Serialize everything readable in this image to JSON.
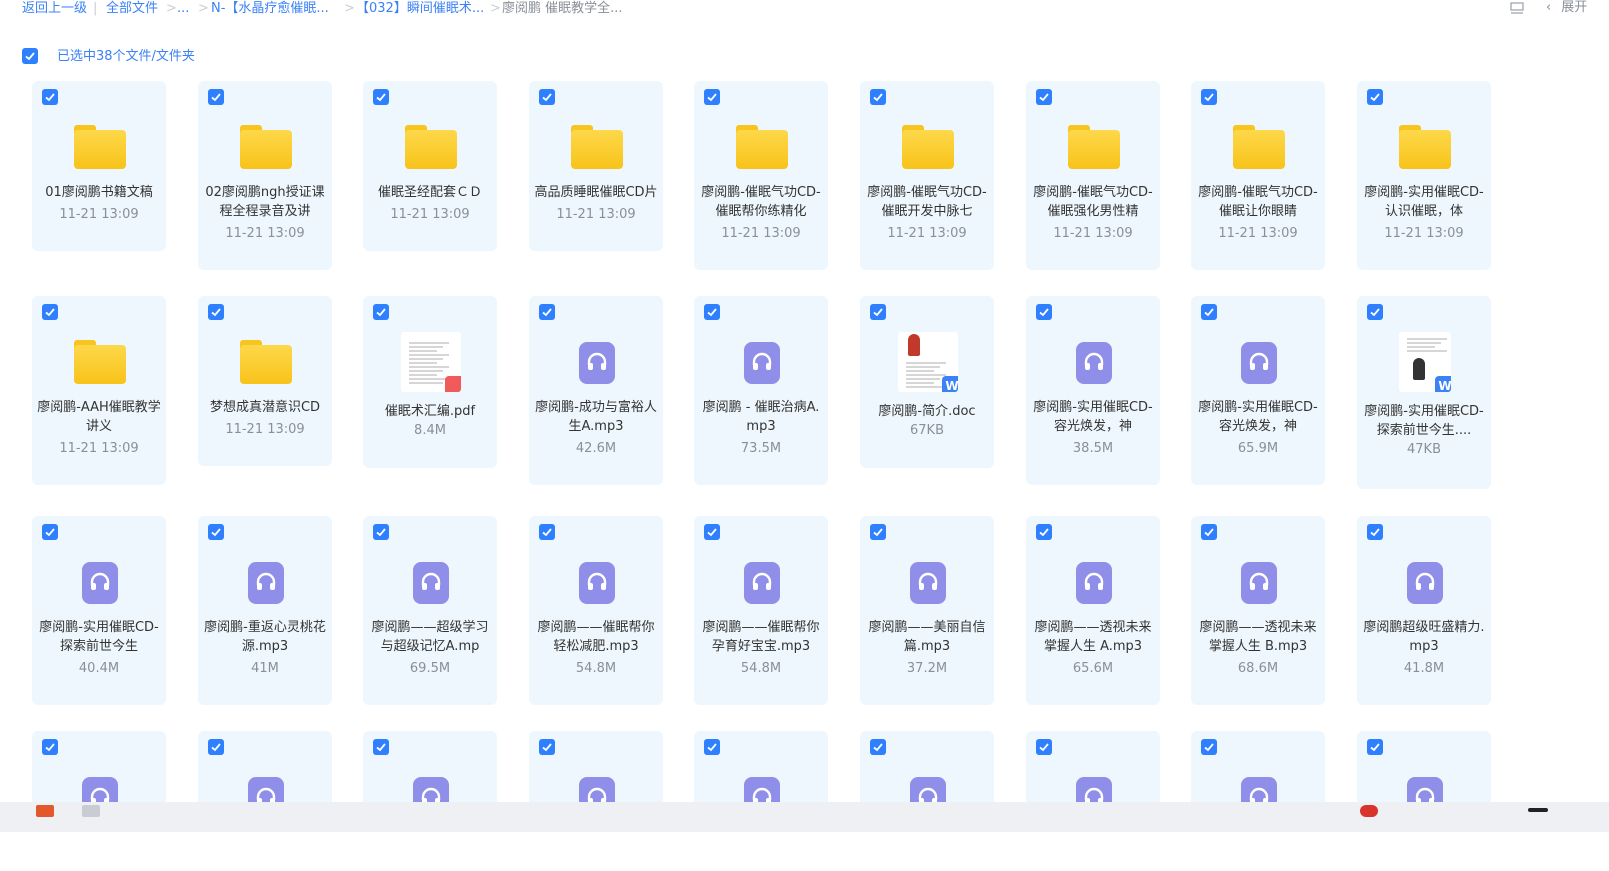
{
  "breadcrumb": {
    "back": "返回上一级",
    "separator": "|",
    "all_files": "全部文件",
    "arrow": ">",
    "ellipsis": "...",
    "folder1": "N-【水晶疗愈催眠...",
    "folder2": "【032】瞬间催眠术...",
    "current": "廖阅鹏 催眠教学全..."
  },
  "toolbar": {
    "expand_label": "展开"
  },
  "selection": {
    "label": "已选中38个文件/文件夹"
  },
  "files": [
    {
      "name": "01廖阅鹏书籍文稿",
      "meta": "11-21 13:09",
      "kind": "folder"
    },
    {
      "name": "02廖阅鹏ngh授证课程全程录音及讲",
      "meta": "11-21 13:09",
      "kind": "folder"
    },
    {
      "name": "催眠圣经配套ＣＤ",
      "meta": "11-21 13:09",
      "kind": "folder"
    },
    {
      "name": "高品质睡眠催眠CD片",
      "meta": "11-21 13:09",
      "kind": "folder"
    },
    {
      "name": "廖阅鹏-催眠气功CD-催眠帮你练精化",
      "meta": "11-21 13:09",
      "kind": "folder"
    },
    {
      "name": "廖阅鹏-催眠气功CD-催眠开发中脉七",
      "meta": "11-21 13:09",
      "kind": "folder"
    },
    {
      "name": "廖阅鹏-催眠气功CD-催眠强化男性精",
      "meta": "11-21 13:09",
      "kind": "folder"
    },
    {
      "name": "廖阅鹏-催眠气功CD-催眠让你眼睛",
      "meta": "11-21 13:09",
      "kind": "folder"
    },
    {
      "name": "廖阅鹏-实用催眠CD-认识催眠，体",
      "meta": "11-21 13:09",
      "kind": "folder"
    },
    {
      "name": "廖阅鹏-AAH催眠教学讲义",
      "meta": "11-21 13:09",
      "kind": "folder"
    },
    {
      "name": "梦想成真潜意识CD",
      "meta": "11-21 13:09",
      "kind": "folder"
    },
    {
      "name": "催眠术汇编.pdf",
      "meta": "8.4M",
      "kind": "pdf"
    },
    {
      "name": "廖阅鹏-成功与富裕人生A.mp3",
      "meta": "42.6M",
      "kind": "audio"
    },
    {
      "name": "廖阅鹏 - 催眠治病A.mp3",
      "meta": "73.5M",
      "kind": "audio"
    },
    {
      "name": "廖阅鹏-简介.doc",
      "meta": "67KB",
      "kind": "doc1"
    },
    {
      "name": "廖阅鹏-实用催眠CD-容光焕发，神",
      "meta": "38.5M",
      "kind": "audio"
    },
    {
      "name": "廖阅鹏-实用催眠CD-容光焕发，神",
      "meta": "65.9M",
      "kind": "audio"
    },
    {
      "name": "廖阅鹏-实用催眠CD-探索前世今生....",
      "meta": "47KB",
      "kind": "doc2"
    },
    {
      "name": "廖阅鹏-实用催眠CD-探索前世今生",
      "meta": "40.4M",
      "kind": "audio"
    },
    {
      "name": "廖阅鹏-重返心灵桃花源.mp3",
      "meta": "41M",
      "kind": "audio"
    },
    {
      "name": "廖阅鹏——超级学习与超级记忆A.mp",
      "meta": "69.5M",
      "kind": "audio"
    },
    {
      "name": "廖阅鹏——催眠帮你轻松减肥.mp3",
      "meta": "54.8M",
      "kind": "audio"
    },
    {
      "name": "廖阅鹏——催眠帮你孕育好宝宝.mp3",
      "meta": "54.8M",
      "kind": "audio"
    },
    {
      "name": "廖阅鹏——美丽自信篇.mp3",
      "meta": "37.2M",
      "kind": "audio"
    },
    {
      "name": "廖阅鹏——透视未来掌握人生 A.mp3",
      "meta": "65.6M",
      "kind": "audio"
    },
    {
      "name": "廖阅鹏——透视未来掌握人生 B.mp3",
      "meta": "68.6M",
      "kind": "audio"
    },
    {
      "name": "廖阅鹏超级旺盛精力.mp3",
      "meta": "41.8M",
      "kind": "audio"
    },
    {
      "name": "",
      "meta": "",
      "kind": "audio"
    },
    {
      "name": "",
      "meta": "",
      "kind": "audio"
    },
    {
      "name": "",
      "meta": "",
      "kind": "audio"
    },
    {
      "name": "",
      "meta": "",
      "kind": "audio"
    },
    {
      "name": "",
      "meta": "",
      "kind": "audio"
    },
    {
      "name": "",
      "meta": "",
      "kind": "audio"
    },
    {
      "name": "",
      "meta": "",
      "kind": "audio"
    },
    {
      "name": "",
      "meta": "",
      "kind": "audio"
    },
    {
      "name": "",
      "meta": "",
      "kind": "audio"
    }
  ],
  "colors": {
    "accent": "#2f80ff",
    "card_bg": "#eef7fd",
    "folder": "#f8c31a",
    "audio": "#8f8ee8",
    "pdf_badge": "#f05a5a",
    "word_badge": "#3b82f6"
  }
}
